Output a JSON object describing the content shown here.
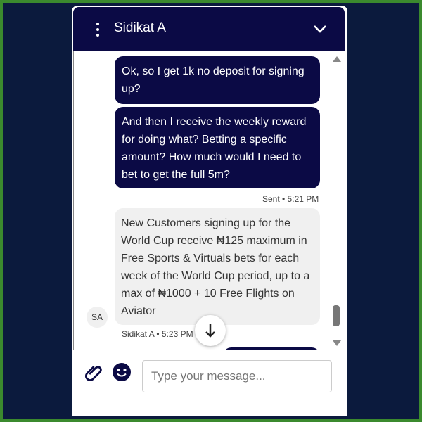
{
  "chat": {
    "contact_name": "Sidikat A",
    "messages": [
      {
        "direction": "out",
        "text": "Ok, so I get 1k no deposit for signing up?"
      },
      {
        "direction": "out",
        "text": "And then I receive the weekly reward for doing what? Betting a specific amount? How much would I need to bet to get the full 5m?"
      }
    ],
    "sent_meta": "Sent • 5:21 PM",
    "incoming": {
      "text": "New Customers signing up for the World Cup receive ₦125 maximum in Free Sports & Virtuals bets for each week of the World Cup period, up to a max of ₦1000 + 10 Free Flights on Aviator",
      "avatar_initials": "SA",
      "meta": "Sidikat A • 5:23 PM"
    }
  },
  "composer": {
    "placeholder": "Type your message..."
  },
  "icons": {
    "menu": "kebab-menu-icon",
    "collapse": "chevron-down-icon",
    "scroll_down": "arrow-down-icon",
    "attach": "paperclip-icon",
    "emoji": "smiley-icon"
  },
  "colors": {
    "header_bg": "#0b0a45",
    "outgoing_bubble": "#0b0a45",
    "incoming_bubble": "#f0f0f0",
    "page_bg": "#0b1a3d",
    "frame": "#3b8a2e"
  }
}
